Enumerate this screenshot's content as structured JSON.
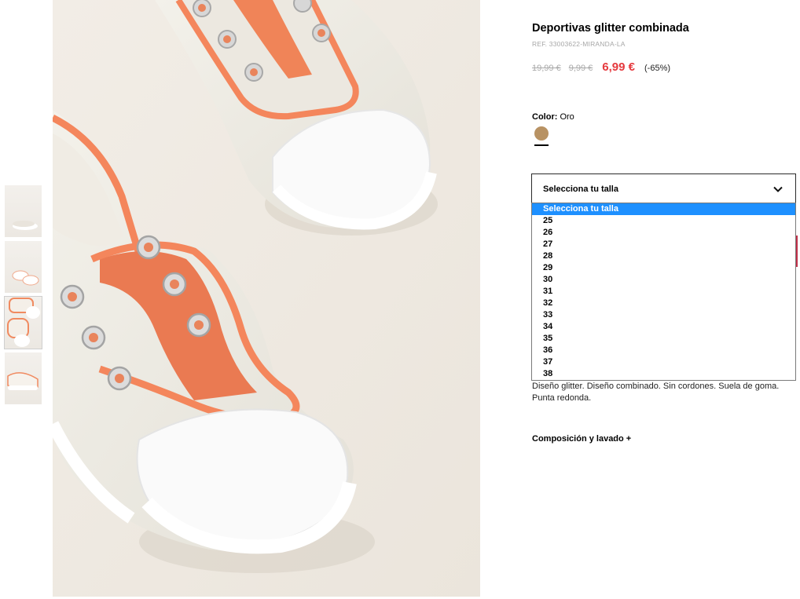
{
  "product": {
    "title": "Deportivas glitter combinada",
    "ref": "REF. 33003622-MIRANDA-LA",
    "price_original": "19,99 €",
    "price_previous": "9,99 €",
    "price_current": "6,99 €",
    "discount": "(-65%)"
  },
  "color": {
    "label": "Color:",
    "value": "Oro",
    "swatch_hex": "#b89263"
  },
  "size_select": {
    "label": "Selecciona tu talla",
    "options": [
      "Selecciona tu talla",
      "25",
      "26",
      "27",
      "28",
      "29",
      "30",
      "31",
      "32",
      "33",
      "34",
      "35",
      "36",
      "37",
      "38"
    ],
    "selected_index": 0
  },
  "description": "Diseño glitter. Diseño combinado. Sin cordones. Suela de goma. Punta redonda.",
  "composition_link": "Composición y lavado +",
  "theme": {
    "accent_price": "#e5393e",
    "select_highlight": "#1e90ff"
  }
}
